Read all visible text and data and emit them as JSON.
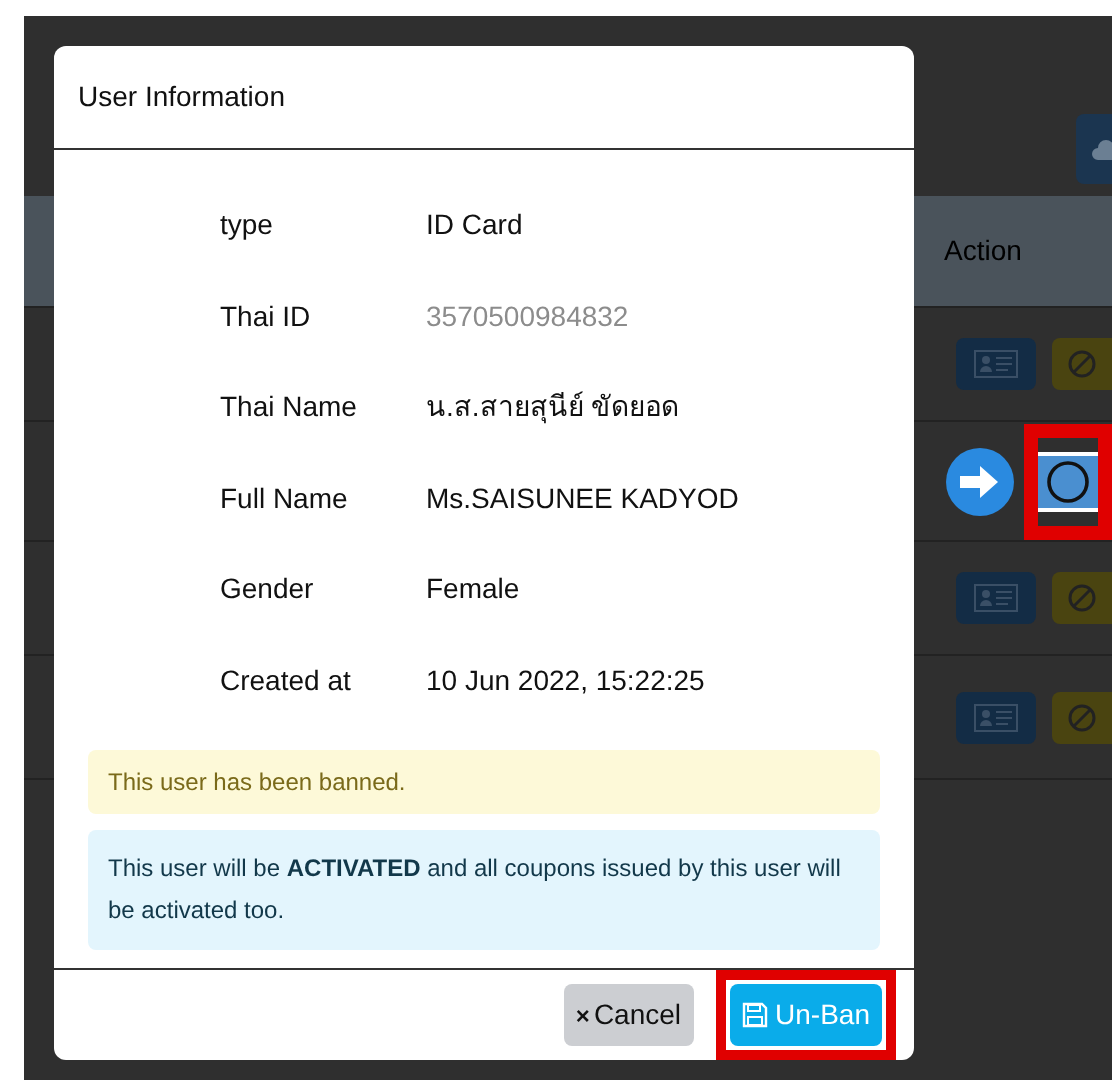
{
  "background_table": {
    "action_header": "Action",
    "rows": [
      {
        "kind": "banned"
      },
      {
        "kind": "highlighted"
      },
      {
        "kind": "banned"
      },
      {
        "kind": "banned"
      }
    ]
  },
  "modal": {
    "title": "User Information",
    "fields": [
      {
        "label": "type",
        "value": "ID Card",
        "blurred": false
      },
      {
        "label": "Thai ID",
        "value": "3570500984832",
        "blurred": true
      },
      {
        "label": "Thai Name",
        "value": "น.ส.สายสุนีย์ ขัดยอด",
        "blurred": false
      },
      {
        "label": "Full Name",
        "value": "Ms.SAISUNEE KADYOD",
        "blurred": false
      },
      {
        "label": "Gender",
        "value": "Female",
        "blurred": false
      },
      {
        "label": "Created at",
        "value": "10 Jun 2022, 15:22:25",
        "blurred": false
      }
    ],
    "alerts": [
      {
        "kind": "warning",
        "text": "This user has been banned."
      },
      {
        "kind": "info",
        "text": "This user will be **ACTIVATED** and all coupons issued by this user will be activated too."
      }
    ],
    "buttons": [
      {
        "kind": "cancel",
        "icon": "×",
        "label": "Cancel",
        "highlighted": false
      },
      {
        "kind": "confirm",
        "label": "Un-Ban",
        "highlighted": true
      }
    ]
  }
}
